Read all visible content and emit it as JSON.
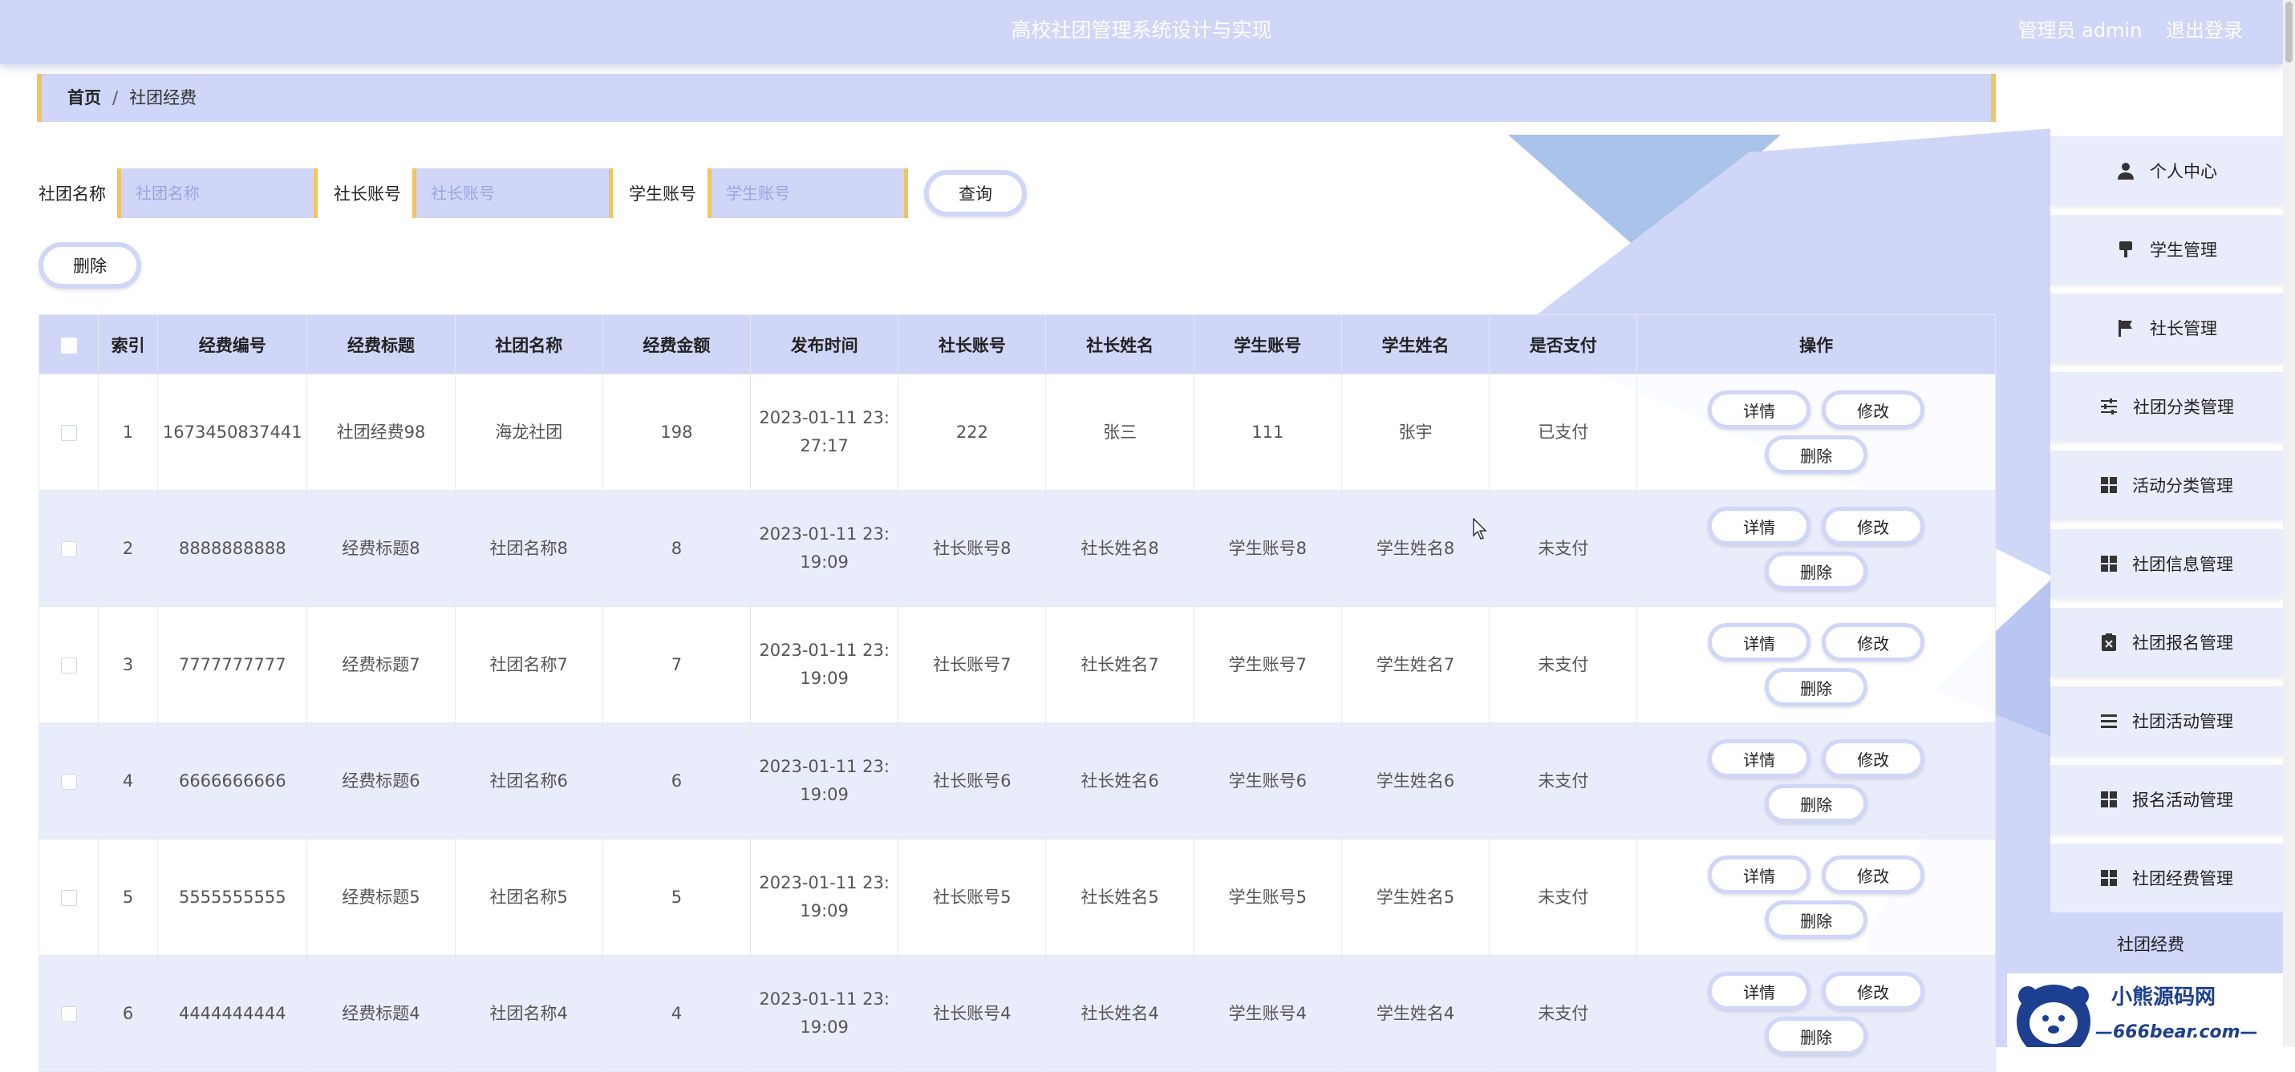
{
  "header": {
    "title": "高校社团管理系统设计与实现",
    "user_label": "管理员 admin",
    "logout_label": "退出登录"
  },
  "breadcrumb": {
    "home": "首页",
    "separator": "/",
    "current": "社团经费"
  },
  "search": {
    "club_label": "社团名称",
    "club_placeholder": "社团名称",
    "leader_label": "社长账号",
    "leader_placeholder": "社长账号",
    "student_label": "学生账号",
    "student_placeholder": "学生账号",
    "query_label": "查询"
  },
  "batch_delete_label": "删除",
  "table": {
    "headers": [
      "索引",
      "经费编号",
      "经费标题",
      "社团名称",
      "经费金额",
      "发布时间",
      "社长账号",
      "社长姓名",
      "学生账号",
      "学生姓名",
      "是否支付",
      "操作"
    ],
    "actions": {
      "detail": "详情",
      "edit": "修改",
      "delete": "删除"
    },
    "rows": [
      {
        "index": "1",
        "fund_id": "1673450837441",
        "fund_title": "社团经费98",
        "club": "海龙社团",
        "amount": "198",
        "time": "2023-01-11 23:27:17",
        "leader_acc": "222",
        "leader_name": "张三",
        "student_acc": "111",
        "student_name": "张宇",
        "paid": "已支付"
      },
      {
        "index": "2",
        "fund_id": "8888888888",
        "fund_title": "经费标题8",
        "club": "社团名称8",
        "amount": "8",
        "time": "2023-01-11 23:19:09",
        "leader_acc": "社长账号8",
        "leader_name": "社长姓名8",
        "student_acc": "学生账号8",
        "student_name": "学生姓名8",
        "paid": "未支付"
      },
      {
        "index": "3",
        "fund_id": "7777777777",
        "fund_title": "经费标题7",
        "club": "社团名称7",
        "amount": "7",
        "time": "2023-01-11 23:19:09",
        "leader_acc": "社长账号7",
        "leader_name": "社长姓名7",
        "student_acc": "学生账号7",
        "student_name": "学生姓名7",
        "paid": "未支付"
      },
      {
        "index": "4",
        "fund_id": "6666666666",
        "fund_title": "经费标题6",
        "club": "社团名称6",
        "amount": "6",
        "time": "2023-01-11 23:19:09",
        "leader_acc": "社长账号6",
        "leader_name": "社长姓名6",
        "student_acc": "学生账号6",
        "student_name": "学生姓名6",
        "paid": "未支付"
      },
      {
        "index": "5",
        "fund_id": "5555555555",
        "fund_title": "经费标题5",
        "club": "社团名称5",
        "amount": "5",
        "time": "2023-01-11 23:19:09",
        "leader_acc": "社长账号5",
        "leader_name": "社长姓名5",
        "student_acc": "学生账号5",
        "student_name": "学生姓名5",
        "paid": "未支付"
      },
      {
        "index": "6",
        "fund_id": "4444444444",
        "fund_title": "经费标题4",
        "club": "社团名称4",
        "amount": "4",
        "time": "2023-01-11 23:19:09",
        "leader_acc": "社长账号4",
        "leader_name": "社长姓名4",
        "student_acc": "学生账号4",
        "student_name": "学生姓名4",
        "paid": "未支付"
      }
    ]
  },
  "sidebar": {
    "items": [
      {
        "label": "个人中心",
        "icon": "user-icon"
      },
      {
        "label": "学生管理",
        "icon": "brush-icon"
      },
      {
        "label": "社长管理",
        "icon": "flag-icon"
      },
      {
        "label": "社团分类管理",
        "icon": "sliders-icon"
      },
      {
        "label": "活动分类管理",
        "icon": "grid-icon"
      },
      {
        "label": "社团信息管理",
        "icon": "grid-icon"
      },
      {
        "label": "社团报名管理",
        "icon": "clipboard-icon"
      },
      {
        "label": "社团活动管理",
        "icon": "list-icon"
      },
      {
        "label": "报名活动管理",
        "icon": "grid-icon"
      },
      {
        "label": "社团经费管理",
        "icon": "grid-icon"
      }
    ],
    "sub_item": "社团经费"
  },
  "watermark": {
    "brand": "小熊源码网",
    "url": "—666bear.com—"
  },
  "colors": {
    "primary": "#cfd6f7",
    "accent": "#f2c45a",
    "row_alt": "#e9ecfb"
  }
}
